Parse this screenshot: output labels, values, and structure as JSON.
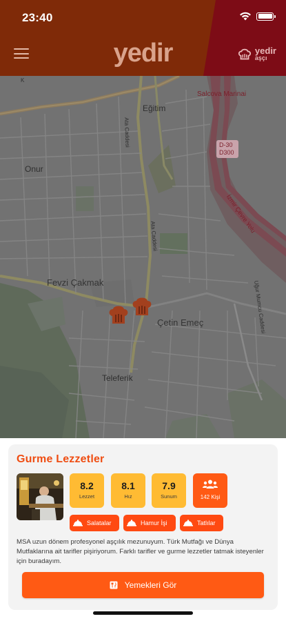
{
  "status_bar": {
    "time": "23:40"
  },
  "header": {
    "logo": "yedir",
    "brand_main": "yedir",
    "brand_sub": "aşçı"
  },
  "colors": {
    "header": "#7f2a08",
    "header_right": "#7d0c16",
    "accent": "#ff5a14",
    "score_bg": "#ffbb33",
    "title": "#ef4d12"
  },
  "map": {
    "labels": {
      "egitim": "Eğitim",
      "onur": "Onur",
      "fevzi": "Fevzi Çakmak",
      "cetin": "Çetin Emeç",
      "teleferik": "Teleferik",
      "salcova": "Salcova Marinai",
      "d30": "D-30",
      "d300": "D300",
      "izmir": "İzmir Çevre Yolu",
      "ata": "Ata Caddesi",
      "ata2": "Ata Caddesi",
      "ugur": "Uğur Mumcu Caddesi",
      "k": "K"
    }
  },
  "card": {
    "title": "Gurme Lezzetler",
    "scores": [
      {
        "value": "8.2",
        "label": "Lezzet"
      },
      {
        "value": "8.1",
        "label": "Hız"
      },
      {
        "value": "7.9",
        "label": "Sunum"
      }
    ],
    "people": "142 Kişi",
    "tags": [
      "Salatalar",
      "Hamur İşi",
      "Tatlılar"
    ],
    "description": "MSA uzun dönem profesyonel aşçılık mezunuyum. Türk Mutfağı ve Dünya Mutfaklarına ait tarifler pişiriyorum. Farklı tarifler ve gurme lezzetler tatmak isteyenler için buradayım.",
    "cta": "Yemekleri Gör"
  }
}
